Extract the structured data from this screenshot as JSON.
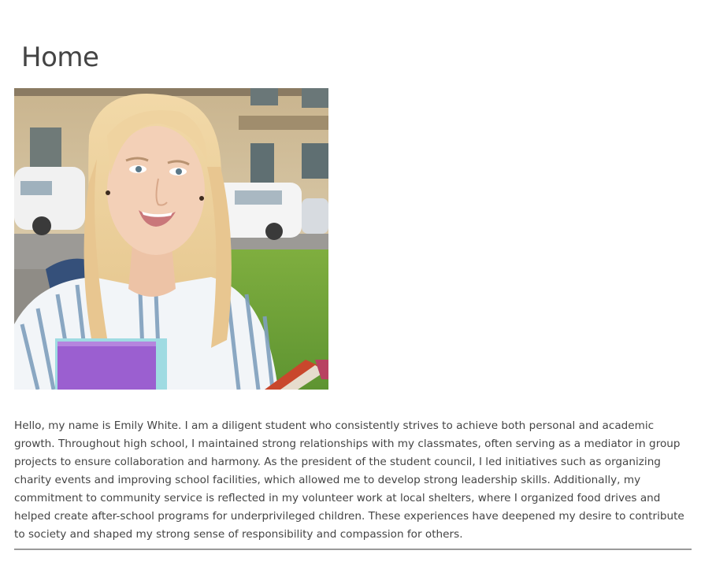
{
  "page": {
    "title": "Home"
  },
  "profile": {
    "bio": "Hello, my name is Emily White. I am a diligent student who consistently strives to achieve both personal and academic growth. Throughout high school, I maintained strong relationships with my classmates, often serving as a mediator in group projects to ensure collaboration and harmony. As the president of the student council, I led initiatives such as organizing charity events and improving school facilities, which allowed me to develop strong leadership skills. Additionally, my commitment to community service is reflected in my volunteer work at local shelters, where I organized food drives and helped create after-school programs for underprivileged children. These experiences have deepened my desire to contribute to society and shaped my strong sense of responsibility and compassion for others."
  },
  "colors": {
    "text": "#444444",
    "divider": "#9a9a9a",
    "background": "#ffffff"
  }
}
